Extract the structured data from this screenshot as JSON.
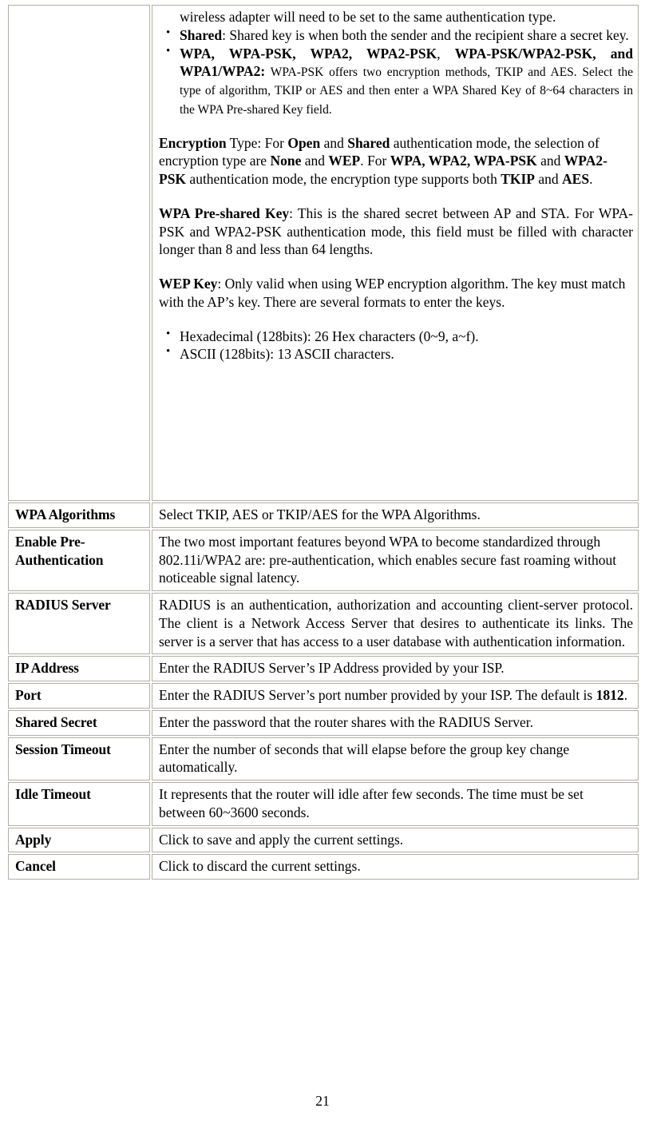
{
  "document": {
    "page_number": "21"
  },
  "intro_cell": {
    "continued_line": "wireless adapter will need to be set to the same authentication type.",
    "bullets": [
      {
        "bold": "Shared",
        "rest": ": Shared key is when both the sender and the recipient share a secret key."
      },
      {
        "bold": "WPA, WPA-PSK, WPA2, WPA2-PSK",
        "bold_mid": ", ",
        "bold2": "WPA-PSK/WPA2-PSK, and WPA1/WPA2:",
        "rest": " WPA-PSK offers two encryption methods, TKIP and AES. Select the type of algorithm, TKIP or AES and then enter a WPA Shared Key of 8~64 characters in the WPA Pre-shared Key field."
      }
    ],
    "encryption_paragraph": {
      "t1": "Encryption",
      "t2": " Type: For ",
      "t3": "Open",
      "t4": " and ",
      "t5": "Shared",
      "t6": " authentication mode, the selection of encryption type are ",
      "t7": "None",
      "t8": " and ",
      "t9": "WEP",
      "t10": ". For ",
      "t11": "WPA, WPA2, WPA-PSK",
      "t12": " and ",
      "t13": "WPA2-PSK",
      "t14": " authentication mode, the encryption type supports both ",
      "t15": "TKIP",
      "t16": " and ",
      "t17": "AES",
      "t18": "."
    },
    "wpa_preshared_paragraph": {
      "t1": "WPA Pre-shared Key",
      "t2": ": This is the shared secret between AP and STA. For WPA-PSK and WPA2-PSK authentication mode, this field must be filled with character longer than 8 and less than 64 lengths."
    },
    "wep_key_paragraph": {
      "t1": "WEP Key",
      "t2": ": Only valid when using WEP encryption algorithm. The key must match with the AP’s key. There are several formats to enter the keys."
    },
    "wep_bullets": [
      "Hexadecimal (128bits): 26 Hex characters (0~9, a~f).",
      "ASCII (128bits): 13 ASCII characters."
    ]
  },
  "rows": [
    {
      "label": "WPA Algorithms",
      "desc": "Select TKIP, AES or TKIP/AES for the WPA Algorithms."
    },
    {
      "label": "Enable Pre-Authentication",
      "desc": "The two most important features beyond WPA to become standardized through 802.11i/WPA2 are: pre-authentication, which enables secure fast roaming without noticeable signal latency."
    },
    {
      "label": "RADIUS Server",
      "desc": "RADIUS is an authentication, authorization and accounting client-server protocol. The client is a Network Access Server that desires to authenticate its links. The server is a server that has access to a user database with authentication information."
    },
    {
      "label": "IP Address",
      "desc": "Enter the RADIUS Server’s IP Address provided by your ISP."
    },
    {
      "label": "Port",
      "desc_pre": "Enter the RADIUS Server’s port number provided by your ISP. The default is ",
      "desc_bold": "1812",
      "desc_post": "."
    },
    {
      "label": "Shared Secret",
      "desc": "Enter the password that the router shares with the RADIUS Server."
    },
    {
      "label": "Session Timeout",
      "desc": "Enter the number of seconds that will elapse before the group key change automatically."
    },
    {
      "label": "Idle Timeout",
      "desc": "It represents that the router will idle after few seconds. The time must be set between 60~3600 seconds."
    },
    {
      "label": "Apply",
      "desc": "Click to save and apply the current settings."
    },
    {
      "label": "Cancel",
      "desc": "Click to discard the current settings."
    }
  ]
}
